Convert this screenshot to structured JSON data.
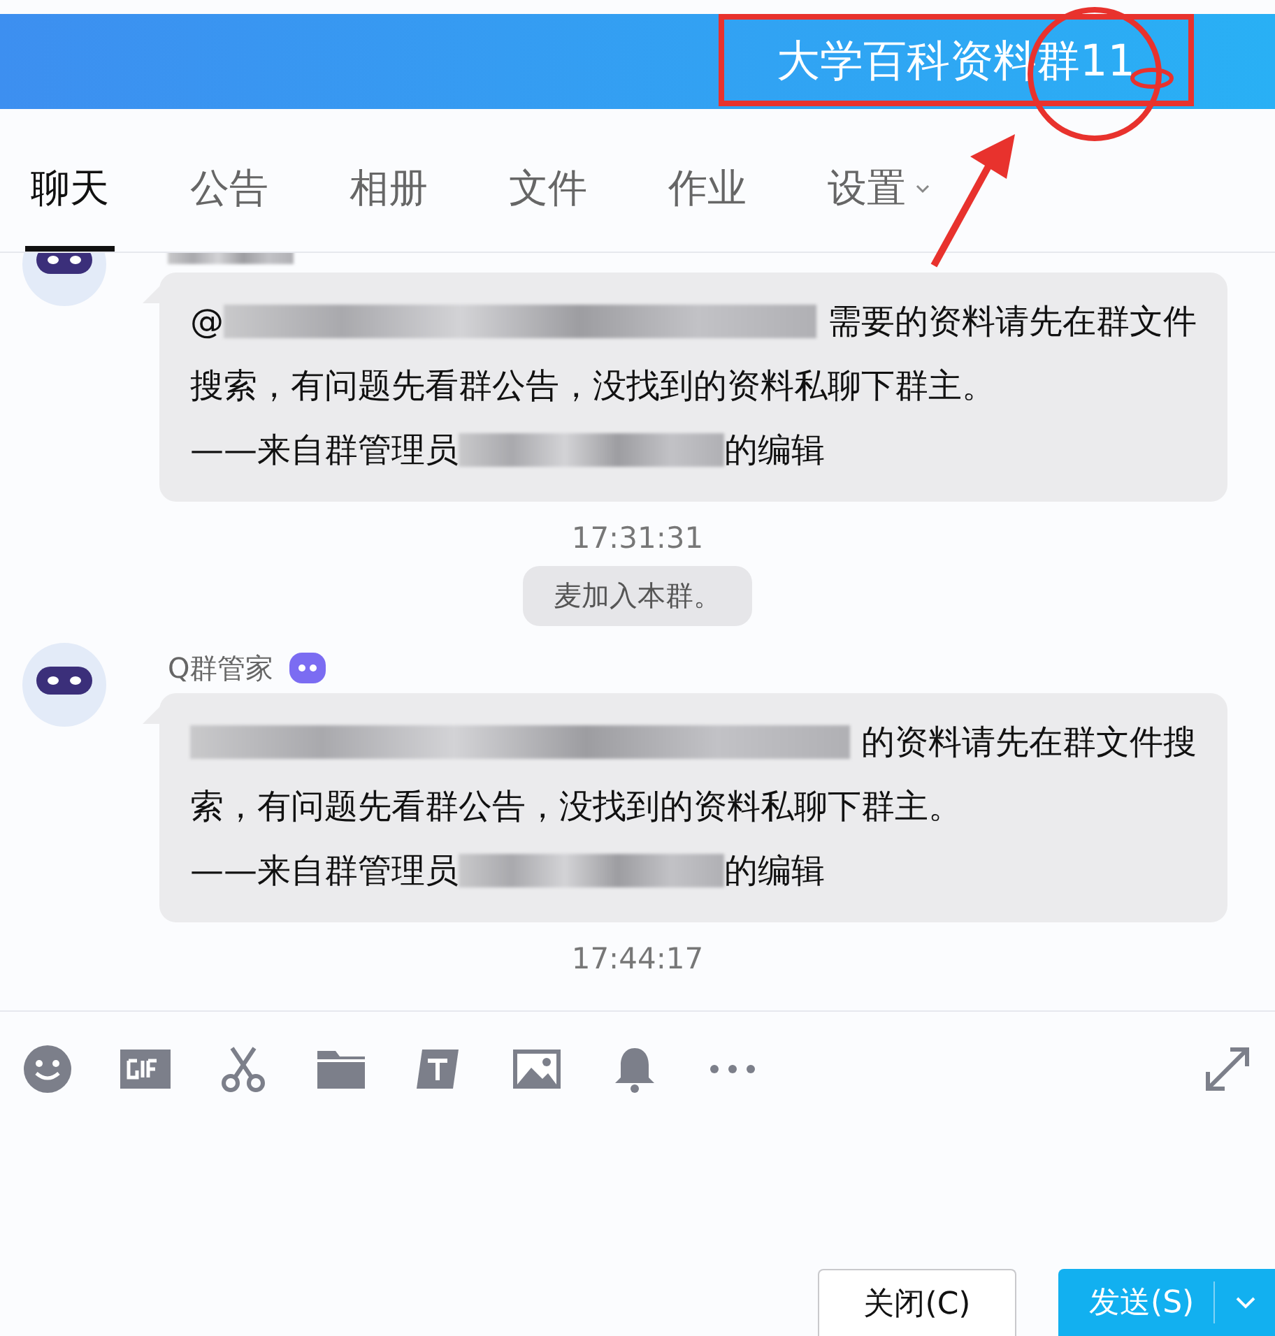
{
  "window": {
    "title": "大学百科资料群11"
  },
  "tabs": [
    {
      "label": "聊天",
      "selected": true,
      "dropdown": false
    },
    {
      "label": "公告",
      "selected": false,
      "dropdown": false
    },
    {
      "label": "相册",
      "selected": false,
      "dropdown": false
    },
    {
      "label": "文件",
      "selected": false,
      "dropdown": false
    },
    {
      "label": "作业",
      "selected": false,
      "dropdown": false
    },
    {
      "label": "设置",
      "selected": false,
      "dropdown": true
    }
  ],
  "messages": [
    {
      "kind": "message",
      "badge": false,
      "sender": [
        {
          "kind": "redacted"
        }
      ],
      "lines": [
        [
          {
            "kind": "text",
            "text": "@"
          },
          {
            "kind": "redacted"
          },
          {
            "kind": "text",
            "text": "需要的资料请先在群文件"
          }
        ],
        [
          {
            "kind": "text",
            "text": "搜索，有问题先看群公告，没找到的资料私聊下群主。"
          }
        ],
        [
          {
            "kind": "text",
            "text": "——来自群管理员"
          },
          {
            "kind": "redacted"
          },
          {
            "kind": "text",
            "text": "的编辑"
          }
        ]
      ]
    },
    {
      "kind": "time",
      "text": "17:31:31"
    },
    {
      "kind": "notice",
      "text": "麦加入本群。"
    },
    {
      "kind": "message",
      "badge": true,
      "sender": [
        {
          "kind": "text",
          "text": "Q群管家"
        }
      ],
      "lines": [
        [
          {
            "kind": "redacted"
          },
          {
            "kind": "text",
            "text": "的资料请先在群文件搜"
          }
        ],
        [
          {
            "kind": "text",
            "text": "索，有问题先看群公告，没找到的资料私聊下群主。"
          }
        ],
        [
          {
            "kind": "text",
            "text": "——来自群管理员"
          },
          {
            "kind": "redacted"
          },
          {
            "kind": "text",
            "text": "的编辑"
          }
        ]
      ]
    },
    {
      "kind": "time",
      "text": "17:44:17"
    }
  ],
  "buttons": [
    {
      "kind": "close",
      "label": "关闭(C)"
    },
    {
      "kind": "send",
      "label": "发送(S)"
    }
  ],
  "annotations": [
    {
      "kind": "box"
    },
    {
      "kind": "circle"
    },
    {
      "kind": "arrow"
    }
  ]
}
